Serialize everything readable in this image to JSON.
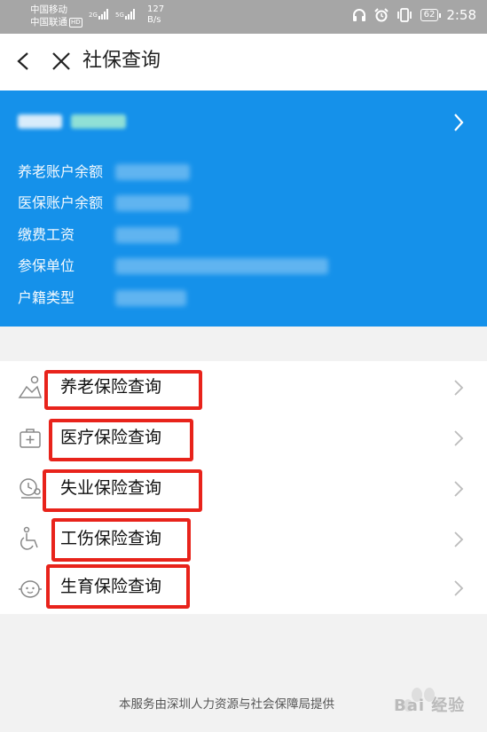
{
  "status_bar": {
    "carrier1": "中国移动",
    "carrier2": "中国联通",
    "hd_badge": "HD",
    "net1": "2G",
    "net2": "5G",
    "speed_value": "127",
    "speed_unit": "B/s",
    "battery": "62",
    "time": "2:58"
  },
  "header": {
    "title": "社保查询"
  },
  "account": {
    "fields": [
      {
        "label": "养老账户余额"
      },
      {
        "label": "医保账户余额"
      },
      {
        "label": "缴费工资"
      },
      {
        "label": "参保单位"
      },
      {
        "label": "户籍类型"
      }
    ]
  },
  "menu": {
    "items": [
      {
        "label": "养老保险查询",
        "icon": "elderly-person-icon"
      },
      {
        "label": "医疗保险查询",
        "icon": "medical-kit-icon"
      },
      {
        "label": "失业保险查询",
        "icon": "clock-person-icon"
      },
      {
        "label": "工伤保险查询",
        "icon": "wheelchair-icon"
      },
      {
        "label": "生育保险查询",
        "icon": "baby-face-icon"
      }
    ]
  },
  "footer": {
    "text": "本服务由深圳人力资源与社会保障局提供"
  },
  "watermark": {
    "text": "Bai 经验"
  },
  "colors": {
    "card_blue": "#1591ea",
    "highlight_red": "#e8231b",
    "status_gray": "#a6a6a6"
  }
}
